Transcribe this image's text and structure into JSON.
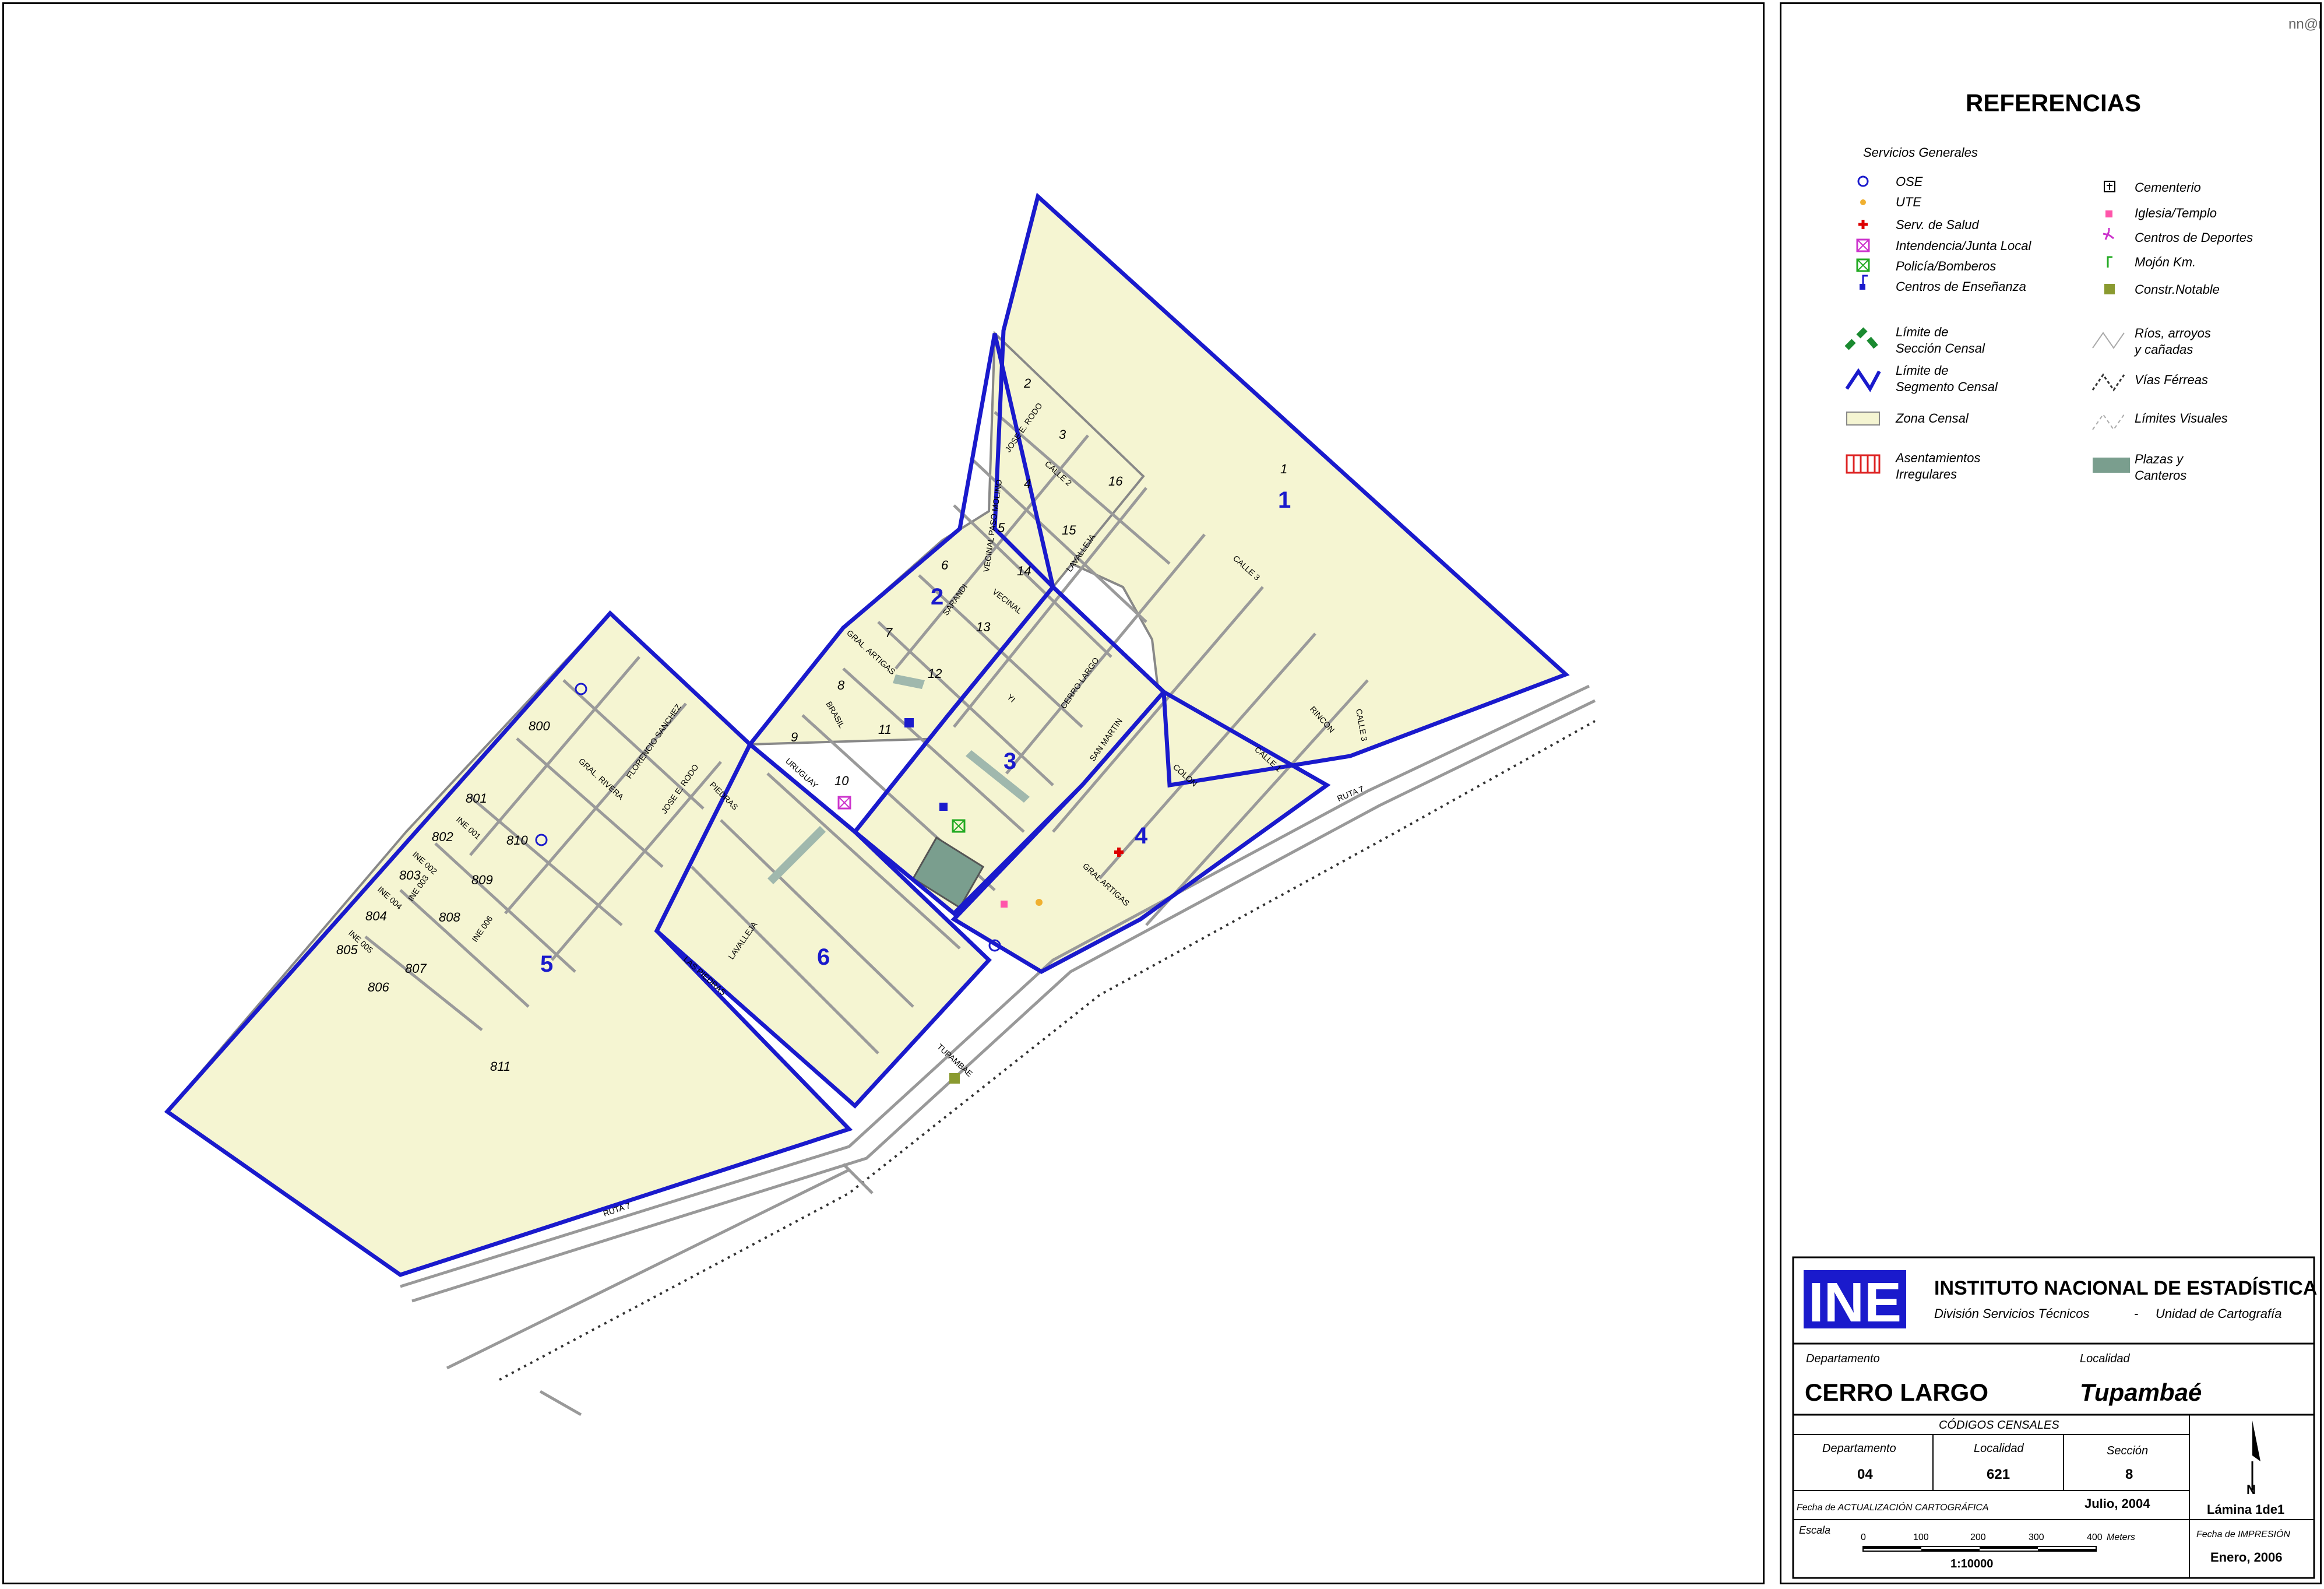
{
  "header": {
    "author": "nn@mg"
  },
  "legend": {
    "title": "REFERENCIAS",
    "services_title": "Servicios Generales",
    "left": [
      {
        "icon": "ose-icon",
        "label": "OSE"
      },
      {
        "icon": "ute-icon",
        "label": "UTE"
      },
      {
        "icon": "health-icon",
        "label": "Serv. de Salud"
      },
      {
        "icon": "intendencia-icon",
        "label": "Intendencia/Junta Local"
      },
      {
        "icon": "police-icon",
        "label": "Policía/Bomberos"
      },
      {
        "icon": "school-icon",
        "label": "Centros de Enseñanza"
      }
    ],
    "right": [
      {
        "icon": "cemetery-icon",
        "label": "Cementerio"
      },
      {
        "icon": "church-icon",
        "label": "Iglesia/Templo"
      },
      {
        "icon": "sports-icon",
        "label": "Centros de Deportes"
      },
      {
        "icon": "km-marker-icon",
        "label": "Mojón Km."
      },
      {
        "icon": "landmark-icon",
        "label": "Constr.Notable"
      }
    ],
    "lines_left": [
      {
        "icon": "section-limit-icon",
        "l1": "Límite de",
        "l2": "Sección Censal"
      },
      {
        "icon": "segment-limit-icon",
        "l1": "Límite de",
        "l2": "Segmento Censal"
      },
      {
        "icon": "census-zone-icon",
        "l1": "Zona Censal",
        "l2": ""
      },
      {
        "icon": "irregular-settlement-icon",
        "l1": "Asentamientos",
        "l2": "Irregulares"
      }
    ],
    "lines_right": [
      {
        "icon": "river-icon",
        "l1": "Ríos, arroyos",
        "l2": "y cañadas"
      },
      {
        "icon": "railway-icon",
        "l1": "Vías Férreas",
        "l2": ""
      },
      {
        "icon": "visual-limit-icon",
        "l1": "Límites  Visuales",
        "l2": ""
      },
      {
        "icon": "plaza-icon",
        "l1": "Plazas y",
        "l2": "Canteros"
      }
    ]
  },
  "title_block": {
    "logo_text": "INE",
    "institute": "INSTITUTO NACIONAL DE ESTADÍSTICA",
    "division": "División Servicios Técnicos",
    "dash": "-",
    "unit": "Unidad de Cartografía",
    "dept_label": "Departamento",
    "dept_value": "CERRO LARGO",
    "loc_label": "Localidad",
    "loc_value": "Tupambaé",
    "codes_title": "CÓDIGOS CENSALES",
    "code_dept_label": "Departamento",
    "code_dept": "04",
    "code_loc_label": "Localidad",
    "code_loc": "621",
    "code_sec_label": "Sección",
    "code_sec": "8",
    "update_label": "Fecha de ACTUALIZACIÓN CARTOGRÁFICA",
    "update_value": "Julio, 2004",
    "sheet": "Lámina 1de1",
    "scale_label": "Escala",
    "scale_ticks": [
      "0",
      "100",
      "200",
      "300",
      "400"
    ],
    "scale_units": "Meters",
    "scale_ratio": "1:10000",
    "print_label": "Fecha de IMPRESIÓN",
    "print_value": "Enero, 2006",
    "north": "N"
  },
  "map": {
    "segments": [
      "1",
      "2",
      "3",
      "4",
      "5",
      "6"
    ],
    "streets": [
      "RUTA 7",
      "RUTA 7",
      "CALLE 3",
      "CALLE 2",
      "CALLE 1",
      "LAVALLEJA",
      "LAVALLEJA",
      "VECINAL PASO MOLINO",
      "VECINAL",
      "SARANDI",
      "GRAL. ARTIGAS",
      "GRAL ARTIGAS",
      "YI",
      "CERRO LARGO",
      "SAN MARTIN",
      "COLON",
      "JOSE E. RODO",
      "JOSE E. RODO",
      "RINCON",
      "CALLE 3",
      "URUGUAY",
      "BRASIL",
      "PIEDRAS",
      "LAS PIEDRAS",
      "FLORENCIO SANCHEZ",
      "GRAL. RIVERA",
      "TUPAMBAE",
      "INE 001",
      "INE 002",
      "INE 003",
      "INE 004",
      "INE 005",
      "INE 006"
    ],
    "blocks": [
      "1",
      "2",
      "3",
      "4",
      "5",
      "6",
      "7",
      "8",
      "9",
      "10",
      "11",
      "12",
      "13",
      "14",
      "15",
      "16",
      "800",
      "801",
      "802",
      "803",
      "804",
      "805",
      "806",
      "807",
      "808",
      "809",
      "810",
      "811"
    ]
  },
  "colors": {
    "zone": "#f5f5d2",
    "segment_line": "#1a1acc",
    "plaza": "#7a9e8e",
    "street": "#999999"
  }
}
